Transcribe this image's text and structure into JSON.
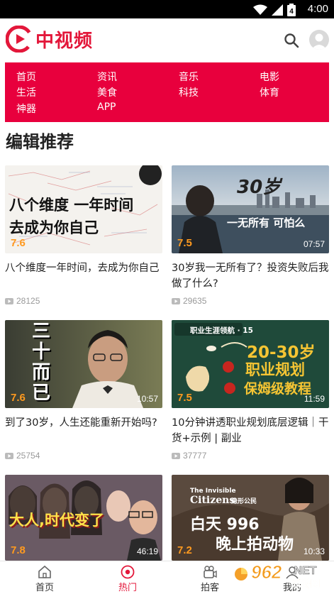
{
  "status_bar": {
    "time": "4:00",
    "battery_level": "4"
  },
  "header": {
    "brand": "中视频"
  },
  "categories": [
    {
      "label": "首页"
    },
    {
      "label": "资讯"
    },
    {
      "label": "音乐"
    },
    {
      "label": "电影"
    },
    {
      "label": "生活"
    },
    {
      "label": "美食"
    },
    {
      "label": "科技"
    },
    {
      "label": "体育"
    },
    {
      "label": "神器"
    },
    {
      "label": "APP"
    }
  ],
  "section_title": "编辑推荐",
  "videos": [
    {
      "title": "八个维度一年时间，去成为你自己",
      "views": "28125",
      "score": "7.6",
      "duration": "",
      "overlay": [
        "八个维度 一年时间",
        "去成为你自己"
      ]
    },
    {
      "title": "30岁我一无所有了？投资失败后我做了什么?",
      "views": "29635",
      "score": "7.5",
      "duration": "07:57",
      "overlay": [
        "30岁",
        "一无所有 可怕么"
      ]
    },
    {
      "title": "到了30岁，人生还能重新开始吗?",
      "views": "25754",
      "score": "7.6",
      "duration": "10:57",
      "overlay": [
        "三",
        "十",
        "而",
        "已"
      ]
    },
    {
      "title": "10分钟讲透职业规划底层逻辑｜干货+示例 | 副业",
      "views": "37777",
      "score": "7.5",
      "duration": "11:59",
      "overlay": [
        "职业生涯领航 · 15",
        "20-30岁",
        "职业规划",
        "保姆级教程"
      ]
    },
    {
      "title": "",
      "views": "",
      "score": "7.8",
      "duration": "46:19",
      "overlay": [
        "大人,时代变了"
      ]
    },
    {
      "title": "",
      "views": "",
      "score": "7.2",
      "duration": "10:33",
      "overlay": [
        "The Invisible",
        "Citizens",
        "隐形公民",
        "白天 996",
        "晚上拍动物"
      ]
    }
  ],
  "bottom_nav": [
    {
      "label": "首页",
      "icon": "home-icon"
    },
    {
      "label": "热门",
      "icon": "hot-icon",
      "active": true
    },
    {
      "label": "拍客",
      "icon": "camera-icon"
    },
    {
      "label": "我的",
      "icon": "profile-icon"
    }
  ],
  "watermark": {
    "number": "962",
    "suffix": ".NET",
    "sub": "乐游网"
  },
  "colors": {
    "brand_red": "#e3173a",
    "category_bg": "#e8003d",
    "score_orange": "#ff9a1f"
  }
}
